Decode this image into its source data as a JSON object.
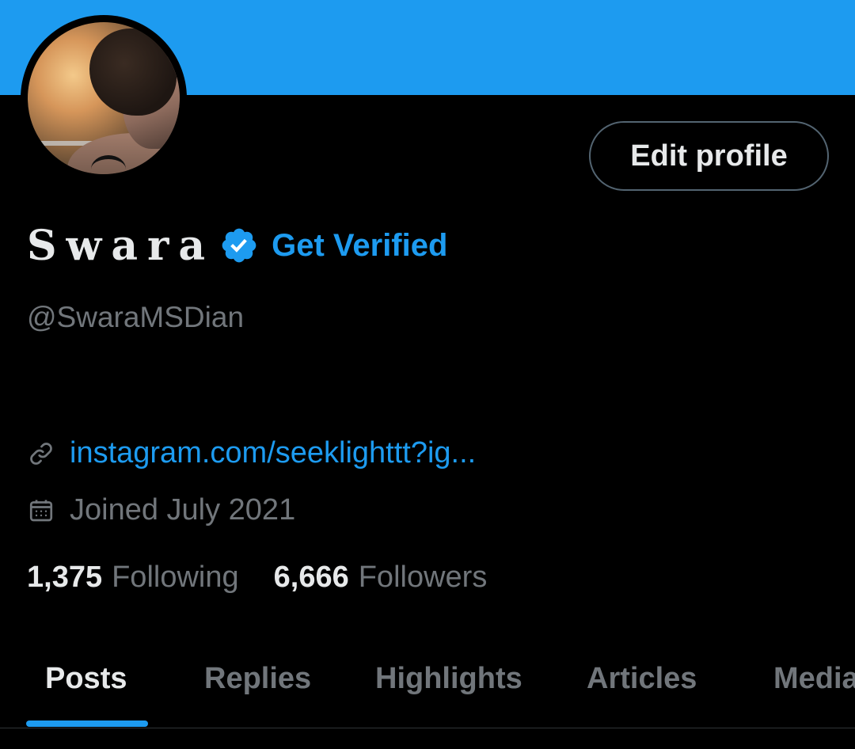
{
  "colors": {
    "banner": "#1d9bf0",
    "background": "#000000",
    "accent": "#1d9bf0",
    "primary_text": "#e7e9ea",
    "secondary_text": "#71767b",
    "border": "#536471"
  },
  "profile": {
    "display_name": "Swara",
    "handle": "@SwaraMSDian",
    "verified_icon": "verified-badge-icon",
    "get_verified_label": "Get Verified",
    "edit_profile_label": "Edit profile",
    "link_icon": "link-icon",
    "link_text": "instagram.com/seeklighttt?ig...",
    "joined_icon": "calendar-icon",
    "joined_text": "Joined July 2021"
  },
  "stats": {
    "following_count": "1,375",
    "following_label": "Following",
    "followers_count": "6,666",
    "followers_label": "Followers"
  },
  "tabs": [
    {
      "label": "Posts",
      "active": true
    },
    {
      "label": "Replies",
      "active": false
    },
    {
      "label": "Highlights",
      "active": false
    },
    {
      "label": "Articles",
      "active": false
    },
    {
      "label": "Media",
      "active": false
    }
  ]
}
